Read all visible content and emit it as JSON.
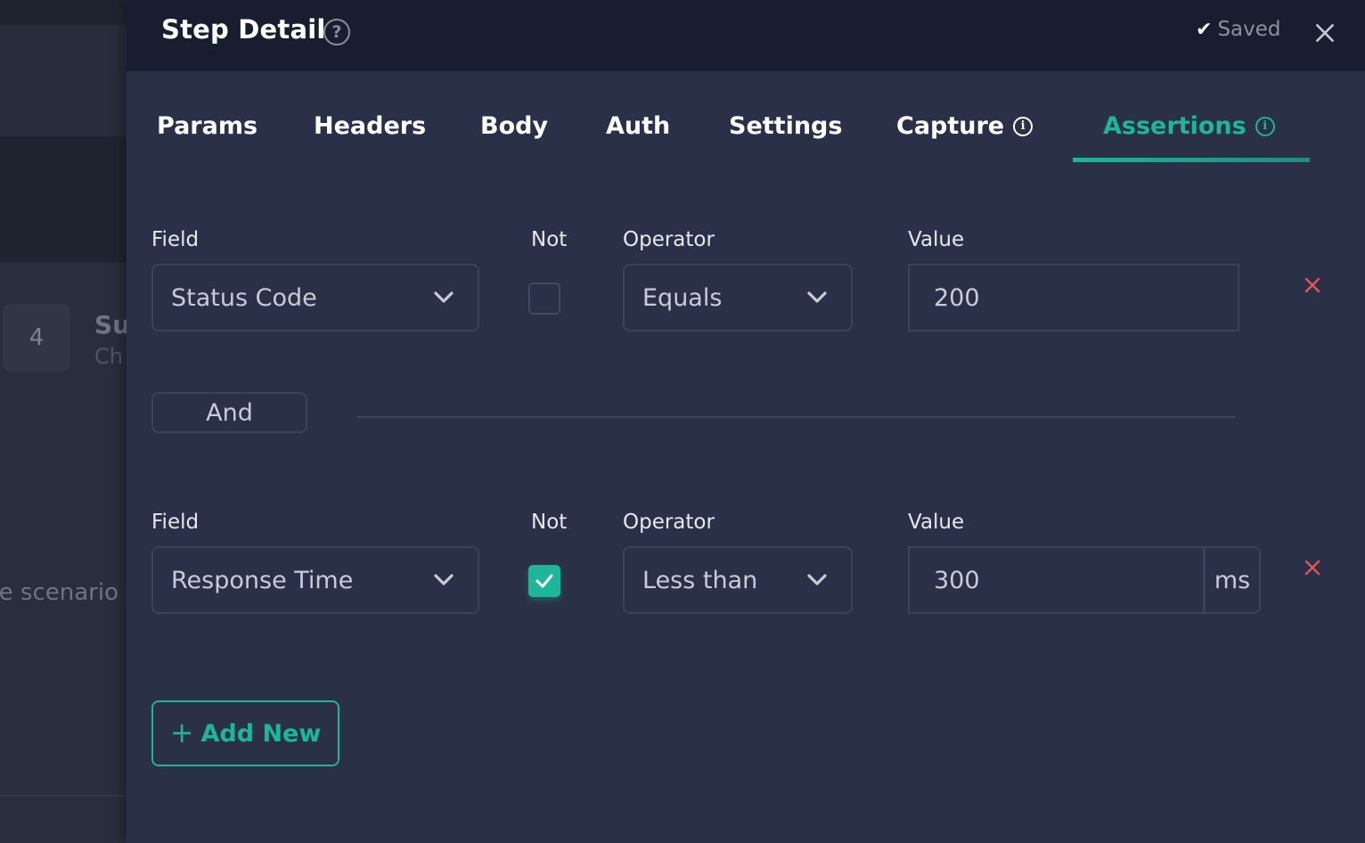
{
  "background": {
    "step_number": "4",
    "step_title_fragment": "Su",
    "step_subtitle_fragment": "Ch",
    "scenario_fragment": "e scenario"
  },
  "drawer": {
    "title": "Step Detail",
    "help_icon": "question-circle-icon",
    "saved_icon": "checkmark-icon",
    "saved_label": "Saved",
    "close_icon": "close-icon"
  },
  "tabs": [
    {
      "label": "Params",
      "active": false
    },
    {
      "label": "Headers",
      "active": false
    },
    {
      "label": "Body",
      "active": false
    },
    {
      "label": "Auth",
      "active": false
    },
    {
      "label": "Settings",
      "active": false
    },
    {
      "label": "Capture",
      "active": false,
      "info_icon": true
    },
    {
      "label": "Assertions",
      "active": true,
      "info_icon": true
    }
  ],
  "assertions": [
    {
      "field_label": "Field",
      "field_value": "Status Code",
      "not_label": "Not",
      "not_checked": false,
      "operator_label": "Operator",
      "operator_value": "Equals",
      "value_label": "Value",
      "value": "200",
      "unit": null
    },
    {
      "field_label": "Field",
      "field_value": "Response Time",
      "not_label": "Not",
      "not_checked": true,
      "operator_label": "Operator",
      "operator_value": "Less than",
      "value_label": "Value",
      "value": "300",
      "unit": "ms"
    }
  ],
  "connector": {
    "label": "And"
  },
  "add_new": {
    "icon": "+",
    "label": "Add New"
  },
  "colors": {
    "accent": "#1fb59a",
    "danger": "#e0565b",
    "header_bg": "#181d2f",
    "panel_bg": "#2a3048"
  }
}
